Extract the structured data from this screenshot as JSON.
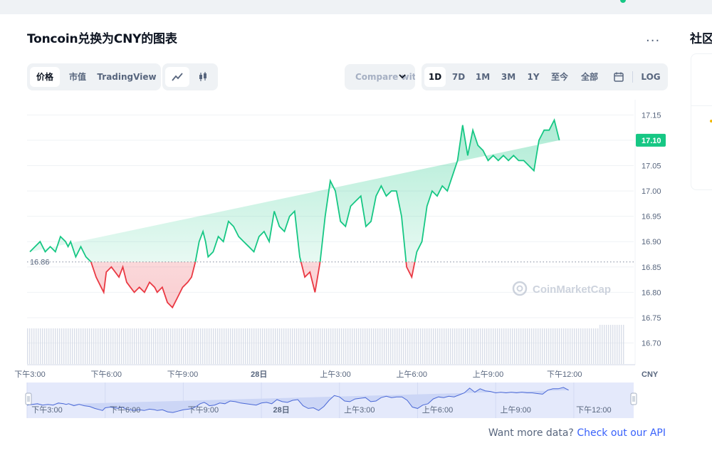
{
  "page": {
    "title": "Toncoin兑换为CNY的图表",
    "more_label": "...",
    "sidebar_title": "社区"
  },
  "toolbar": {
    "tabs": [
      "价格",
      "市值",
      "TradingView"
    ],
    "active_tab": "价格",
    "chart_type_icons": [
      "line-chart-icon",
      "candlestick-icon"
    ],
    "compare_placeholder": "Compare with",
    "ranges": [
      "1D",
      "7D",
      "1M",
      "3M",
      "1Y",
      "至今",
      "全部"
    ],
    "active_range": "1D",
    "calendar_icon": "calendar-icon",
    "log_label": "LOG"
  },
  "footer": {
    "prefix": "Want more data?",
    "link": "Check out our API"
  },
  "watermark": "CoinMarketCap",
  "colors": {
    "up": "#16c784",
    "down": "#ea3943",
    "link": "#3861fb",
    "navigator": "#4a68d6"
  },
  "chart_data": {
    "type": "line",
    "currency_label": "CNY",
    "baseline": 16.86,
    "baseline_label": "16.86",
    "current_value": 17.1,
    "current_label": "17.10",
    "ylim": [
      16.66,
      17.18
    ],
    "yticks": [
      "17.15",
      "17.10",
      "17.05",
      "17.00",
      "16.95",
      "16.90",
      "16.85",
      "16.80",
      "16.75",
      "16.70"
    ],
    "yticks_values": [
      17.15,
      17.1,
      17.05,
      17.0,
      16.95,
      16.9,
      16.85,
      16.8,
      16.75,
      16.7
    ],
    "xticks": [
      "下午3:00",
      "下午6:00",
      "下午9:00",
      "28日",
      "上午3:00",
      "上午6:00",
      "上午9:00",
      "下午12:00"
    ],
    "xticks_hours": [
      0,
      3,
      6,
      9,
      12,
      15,
      18,
      21
    ],
    "x_hours_range": [
      0,
      23.3
    ],
    "series": [
      {
        "hours": [
          0,
          0.2,
          0.4,
          0.6,
          0.8,
          1,
          1.2,
          1.4,
          1.5,
          1.6,
          1.8,
          2,
          2.1,
          2.2,
          2.4,
          2.6,
          2.8,
          2.9,
          3,
          3.2,
          3.35,
          3.5,
          3.65,
          3.8,
          3.95,
          4.1,
          4.3,
          4.5,
          4.7,
          4.9,
          5,
          5.2,
          5.4,
          5.6,
          5.8,
          6,
          6.2,
          6.35,
          6.5,
          6.65,
          6.8,
          6.9,
          7,
          7.2,
          7.4,
          7.6,
          7.8,
          8,
          8.2,
          8.4,
          8.6,
          8.8,
          9,
          9.2,
          9.4,
          9.6,
          9.8,
          10,
          10.2,
          10.4,
          10.6,
          10.8,
          11,
          11.2,
          11.4,
          11.6,
          11.8,
          12,
          12.2,
          12.4,
          12.6,
          12.8,
          13,
          13.2,
          13.4,
          13.6,
          13.8,
          14,
          14.2,
          14.4,
          14.6,
          14.8,
          15,
          15.2,
          15.4,
          15.6,
          15.8,
          16,
          16.2,
          16.4,
          16.6,
          16.8,
          17,
          17.2,
          17.4,
          17.6,
          17.8,
          18,
          18.2,
          18.4,
          18.6,
          18.8,
          19,
          19.2,
          19.4,
          19.6,
          19.8,
          20,
          20.2,
          20.4,
          20.6,
          20.8,
          21,
          21.2,
          21.4,
          21.6,
          21.8,
          22,
          22.2,
          22.4,
          22.6,
          22.8,
          23,
          23.3
        ],
        "values": [
          16.88,
          16.89,
          16.9,
          16.88,
          16.89,
          16.88,
          16.91,
          16.9,
          16.89,
          16.9,
          16.87,
          16.89,
          16.88,
          16.87,
          16.86,
          16.83,
          16.81,
          16.8,
          16.84,
          16.85,
          16.84,
          16.83,
          16.85,
          16.82,
          16.81,
          16.8,
          16.81,
          16.8,
          16.82,
          16.81,
          16.8,
          16.81,
          16.78,
          16.77,
          16.79,
          16.81,
          16.82,
          16.83,
          16.86,
          16.9,
          16.92,
          16.9,
          16.87,
          16.88,
          16.91,
          16.9,
          16.94,
          16.93,
          16.91,
          16.9,
          16.89,
          16.88,
          16.91,
          16.92,
          16.9,
          16.96,
          16.93,
          16.92,
          16.95,
          16.96,
          16.87,
          16.83,
          16.84,
          16.8,
          16.86,
          16.95,
          17.02,
          17.0,
          16.94,
          16.93,
          16.97,
          16.98,
          16.99,
          16.93,
          16.94,
          16.99,
          17.01,
          16.99,
          17.0,
          17.0,
          16.95,
          16.85,
          16.83,
          16.88,
          16.9,
          16.97,
          17.0,
          16.99,
          17.01,
          17.0,
          17.03,
          17.06,
          17.13,
          17.07,
          17.12,
          17.09,
          17.08,
          17.06,
          17.07,
          17.06,
          17.07,
          17.06,
          17.07,
          17.06,
          17.06,
          17.05,
          17.04,
          17.1,
          17.12,
          17.12,
          17.14,
          17.1
        ],
        "color": "#16c784"
      }
    ],
    "navigator": {
      "xticks": [
        "下午3:00",
        "下午6:00",
        "下午9:00",
        "28日",
        "上午3:00",
        "上午6:00",
        "上午9:00",
        "下午12:00"
      ]
    }
  }
}
